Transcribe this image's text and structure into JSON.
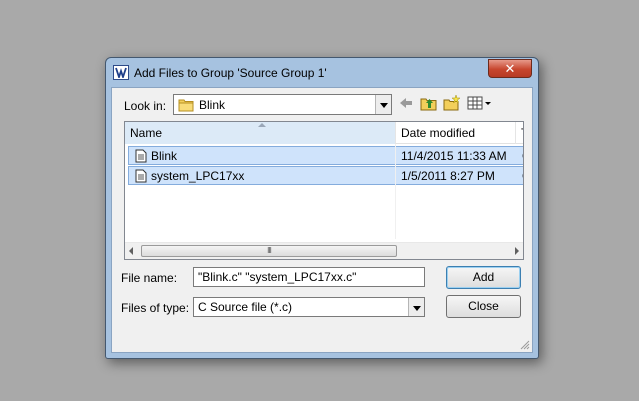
{
  "window": {
    "title": "Add Files to Group 'Source Group 1'",
    "close_label": "✕"
  },
  "look_in": {
    "label": "Look in:",
    "value": "Blink"
  },
  "columns": [
    "Name",
    "Date modified",
    "Ty"
  ],
  "files": [
    {
      "name": "Blink",
      "date": "11/4/2015 11:33 AM",
      "type": "C"
    },
    {
      "name": "system_LPC17xx",
      "date": "1/5/2011 8:27 PM",
      "type": "C"
    }
  ],
  "scroll_grip": "III",
  "file_name": {
    "label": "File name:",
    "value": "\"Blink.c\" \"system_LPC17xx.c\""
  },
  "file_type": {
    "label": "Files of type:",
    "value": "C Source file (*.c)"
  },
  "buttons": {
    "add": "Add",
    "close": "Close"
  },
  "icons": [
    "app-icon",
    "close-icon",
    "folder-icon",
    "back-icon",
    "up-folder-icon",
    "new-folder-icon",
    "view-menu-icon",
    "file-icon",
    "resize-grip-icon"
  ],
  "colors": {
    "selection": "#cfe3fb",
    "selection_border": "#84acdd",
    "frame": "#a6c2e0",
    "close": "#c7462e"
  }
}
